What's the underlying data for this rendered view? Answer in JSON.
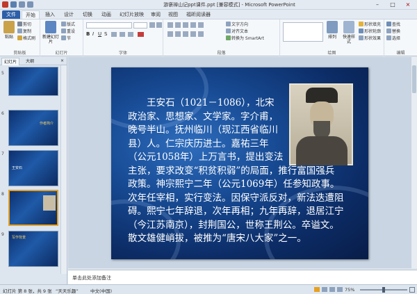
{
  "window": {
    "title": "游褒禅山记ppt课件.ppt [兼容模式] - Microsoft PowerPoint",
    "min_label": "–",
    "max_label": "□",
    "close_label": "×"
  },
  "tabs": [
    "文件",
    "开始",
    "插入",
    "设计",
    "切换",
    "动画",
    "幻灯片放映",
    "审阅",
    "视图",
    "福昕阅读器"
  ],
  "ribbon": {
    "clipboard": {
      "label": "剪贴板",
      "paste": "粘贴",
      "cut": "剪切",
      "copy": "复制",
      "format_painter": "格式刷"
    },
    "slides": {
      "label": "幻灯片",
      "new_slide": "新建幻灯片",
      "layout": "版式",
      "reset": "重设",
      "section": "节"
    },
    "font": {
      "label": "字体"
    },
    "paragraph": {
      "label": "段落",
      "text_direction": "文字方向",
      "align_text": "对齐文本",
      "smartart": "转换为 SmartArt"
    },
    "drawing": {
      "label": "绘图",
      "arrange": "排列",
      "quick_styles": "快速样式",
      "shape_fill": "形状填充",
      "shape_outline": "形状轮廓",
      "shape_effects": "形状效果"
    },
    "editing": {
      "label": "编辑",
      "find": "查找",
      "replace": "替换",
      "select": "选择"
    }
  },
  "panel": {
    "tab_slides": "幻灯片",
    "tab_outline": "大纲",
    "close": "×",
    "thumbnails": [
      {
        "num": "5",
        "text": ""
      },
      {
        "num": "6",
        "text": "作者简介"
      },
      {
        "num": "7",
        "text": "王安石"
      },
      {
        "num": "8",
        "text": ""
      },
      {
        "num": "9",
        "text": "写作背景"
      }
    ]
  },
  "slide": {
    "lines_indented": [
      "王安石（1021－1086），北宋",
      "政治家、思想家、文学家。字介甫，",
      "晚号半山。抚州临川（现江西省临川",
      "县）人。仁宗庆历进士。嘉祐三年"
    ],
    "line_narrow": "（公元1058年）上万言书，提出变法",
    "lines_full": [
      "主张，要求改变“积贫积弱”的局面，推行富国强兵",
      "政策。神宗熙宁二年（公元1069年）任参知政事。",
      "次年任宰相，实行变法。因保守派反对，新法迭遭阻",
      "碍。熙宁七年辞退，次年再相；九年再辞，退居江宁",
      "（今江苏南京），封荆国公，世称王荆公。卒谥文。",
      "散文雄健峭拔，被推为“唐宋八大家”之一。"
    ]
  },
  "notes": {
    "placeholder": "单击此处添加备注"
  },
  "status": {
    "slide_info": "幻灯片 第 8 张，共 9 张",
    "theme": "“天天乐趣”",
    "language": "中文(中国)",
    "zoom": "75%"
  },
  "colors": {
    "file_tab": "#2c5fa8",
    "slide_dark": "#0c2c66",
    "slide_light": "#2e6dbd",
    "selected_thumb": "#e8a020"
  }
}
